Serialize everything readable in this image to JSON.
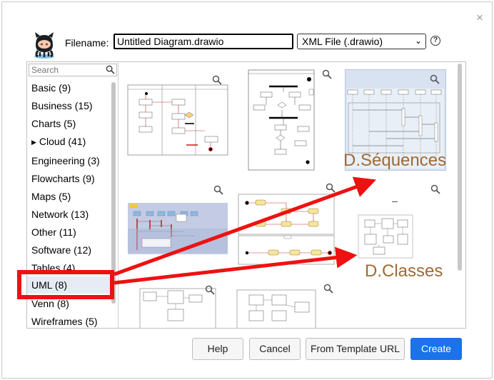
{
  "dialog": {
    "close_glyph": "×",
    "filename_label": "Filename:",
    "filename_value": "Untitled Diagram.drawio",
    "format_selected": "XML File (.drawio)",
    "help_glyph": "?"
  },
  "sidebar": {
    "search_placeholder": "Search",
    "categories": [
      {
        "label": "Basic (9)"
      },
      {
        "label": "Business (15)"
      },
      {
        "label": "Charts (5)"
      },
      {
        "label": "Cloud (41)"
      },
      {
        "label": "Engineering (3)"
      },
      {
        "label": "Flowcharts (9)"
      },
      {
        "label": "Maps (5)"
      },
      {
        "label": "Network (13)"
      },
      {
        "label": "Other (11)"
      },
      {
        "label": "Software (12)"
      },
      {
        "label": "Tables (4)"
      },
      {
        "label": "UML (8)"
      },
      {
        "label": "Venn (8)"
      },
      {
        "label": "Wireframes (5)"
      }
    ],
    "selected": "UML (8)",
    "expander_glyph": "▶"
  },
  "annotations": {
    "sequences": "D.Séquences",
    "classes": "D.Classes",
    "arrow_color": "#ee1111"
  },
  "buttons": {
    "help": "Help",
    "cancel": "Cancel",
    "from_url": "From Template URL",
    "create": "Create"
  },
  "colors": {
    "primary": "#1a73e8",
    "selection": "#e6ebf5",
    "annotation": "#ee1111"
  }
}
